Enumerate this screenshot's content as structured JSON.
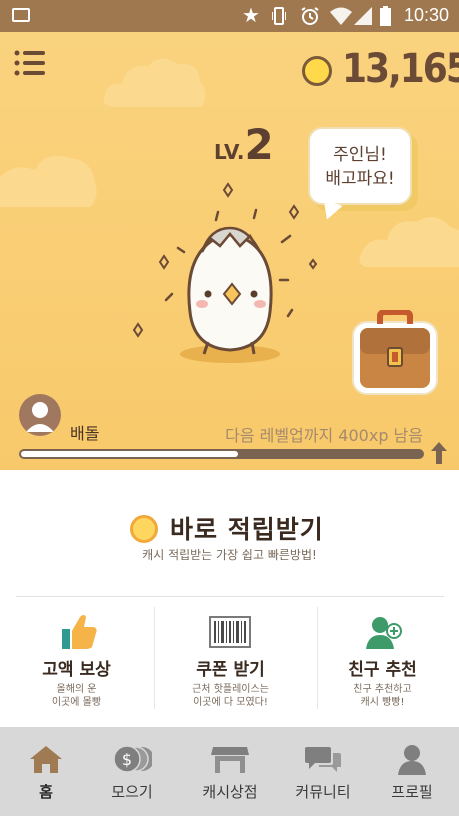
{
  "status_bar": {
    "time": "10:30"
  },
  "header": {
    "menu_icon": "menu-icon",
    "coin_icon": "coin-icon",
    "coin_count": "13,165"
  },
  "character": {
    "level_prefix": "LV.",
    "level": "2",
    "speech": "주인님!\n배고파요!",
    "bag_icon": "treasure-bag-icon"
  },
  "user": {
    "nickname": "배돌",
    "xp_remaining_text": "다음 레벨업까지 400xp 남음",
    "xp_progress": 0.54
  },
  "instant_earn": {
    "title": "바로 적립받기",
    "subtitle": "캐시 적립받는 가장 쉽고 빠른방법!"
  },
  "features": [
    {
      "icon": "thumbs-up-icon",
      "title": "고액 보상",
      "desc": "올해의 운\n이곳에 몰빵"
    },
    {
      "icon": "barcode-icon",
      "title": "쿠폰 받기",
      "desc": "근처 핫플레이스는\n이곳에 다 모였다!"
    },
    {
      "icon": "add-friend-icon",
      "title": "친구 추천",
      "desc": "친구 추천하고\n캐시 빵빵!"
    }
  ],
  "nav": [
    {
      "icon": "home-icon",
      "label": "홈",
      "active": true
    },
    {
      "icon": "coins-icon",
      "label": "모으기"
    },
    {
      "icon": "shop-icon",
      "label": "캐시상점"
    },
    {
      "icon": "chat-icon",
      "label": "커뮤니티"
    },
    {
      "icon": "profile-icon",
      "label": "프로필"
    }
  ],
  "colors": {
    "hero_bg": "#f9cf77",
    "brown": "#6b4a36",
    "nav_bg": "#d8d8d8"
  }
}
